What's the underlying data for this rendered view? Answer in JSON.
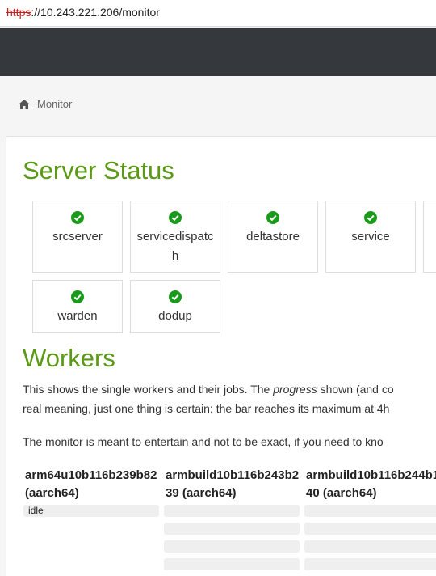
{
  "browser": {
    "scheme": "https",
    "url_rest": "://10.243.221.206/monitor"
  },
  "breadcrumb": {
    "icon": "home-icon",
    "label": "Monitor"
  },
  "server_status": {
    "title": "Server Status",
    "status_icon": "check-circle-icon",
    "status_color": "#1a9a1a",
    "services": [
      {
        "name": "srcserver",
        "status": "ok"
      },
      {
        "name": "servicedispatch",
        "status": "ok"
      },
      {
        "name": "deltastore",
        "status": "ok"
      },
      {
        "name": "service",
        "status": "ok"
      },
      {
        "name": "warden",
        "status": "ok"
      },
      {
        "name": "dodup",
        "status": "ok"
      }
    ]
  },
  "workers": {
    "title": "Workers",
    "intro_before": "This shows the single workers and their jobs. The ",
    "intro_emph": "progress",
    "intro_after": " shown (and co",
    "intro_line2": "real meaning, just one thing is certain: the bar reaches its maximum at 4h",
    "note": "The monitor is meant to entertain and not to be exact, if you need to kno",
    "list": [
      {
        "name": "arm64u10b116b239b82 (aarch64)",
        "job": "idle"
      },
      {
        "name": "armbuild10b116b243b239 (aarch64)",
        "job": ""
      },
      {
        "name": "armbuild10b116b244b140 (aarch64)",
        "job": ""
      }
    ]
  },
  "colors": {
    "heading": "#5b9a16",
    "navbar": "#35383c",
    "bar": "#efefef"
  }
}
